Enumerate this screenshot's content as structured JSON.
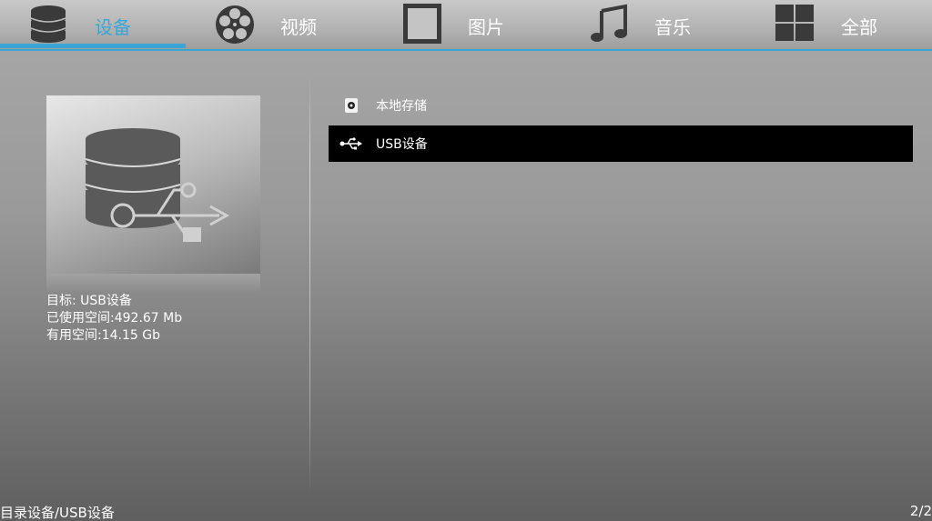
{
  "nav": {
    "tabs": [
      {
        "label": "设备",
        "icon": "database-icon",
        "active": true
      },
      {
        "label": "视频",
        "icon": "film-reel-icon",
        "active": false
      },
      {
        "label": "图片",
        "icon": "picture-frame-icon",
        "active": false
      },
      {
        "label": "音乐",
        "icon": "music-note-icon",
        "active": false
      },
      {
        "label": "全部",
        "icon": "grid-icon",
        "active": false
      }
    ]
  },
  "details": {
    "preview_icon": "usb-storage-icon",
    "target": "目标: USB设备",
    "used_space": "已使用空间:492.67 Mb",
    "free_space": "有用空间:14.15 Gb"
  },
  "devices": [
    {
      "label": "本地存储",
      "icon": "local-storage-icon",
      "selected": false
    },
    {
      "label": "USB设备",
      "icon": "usb-icon",
      "selected": true
    }
  ],
  "status": {
    "path": "目录设备/USB设备",
    "page": "2/2"
  },
  "colors": {
    "accent": "#3aa6d6",
    "selected_row": "#000000"
  }
}
